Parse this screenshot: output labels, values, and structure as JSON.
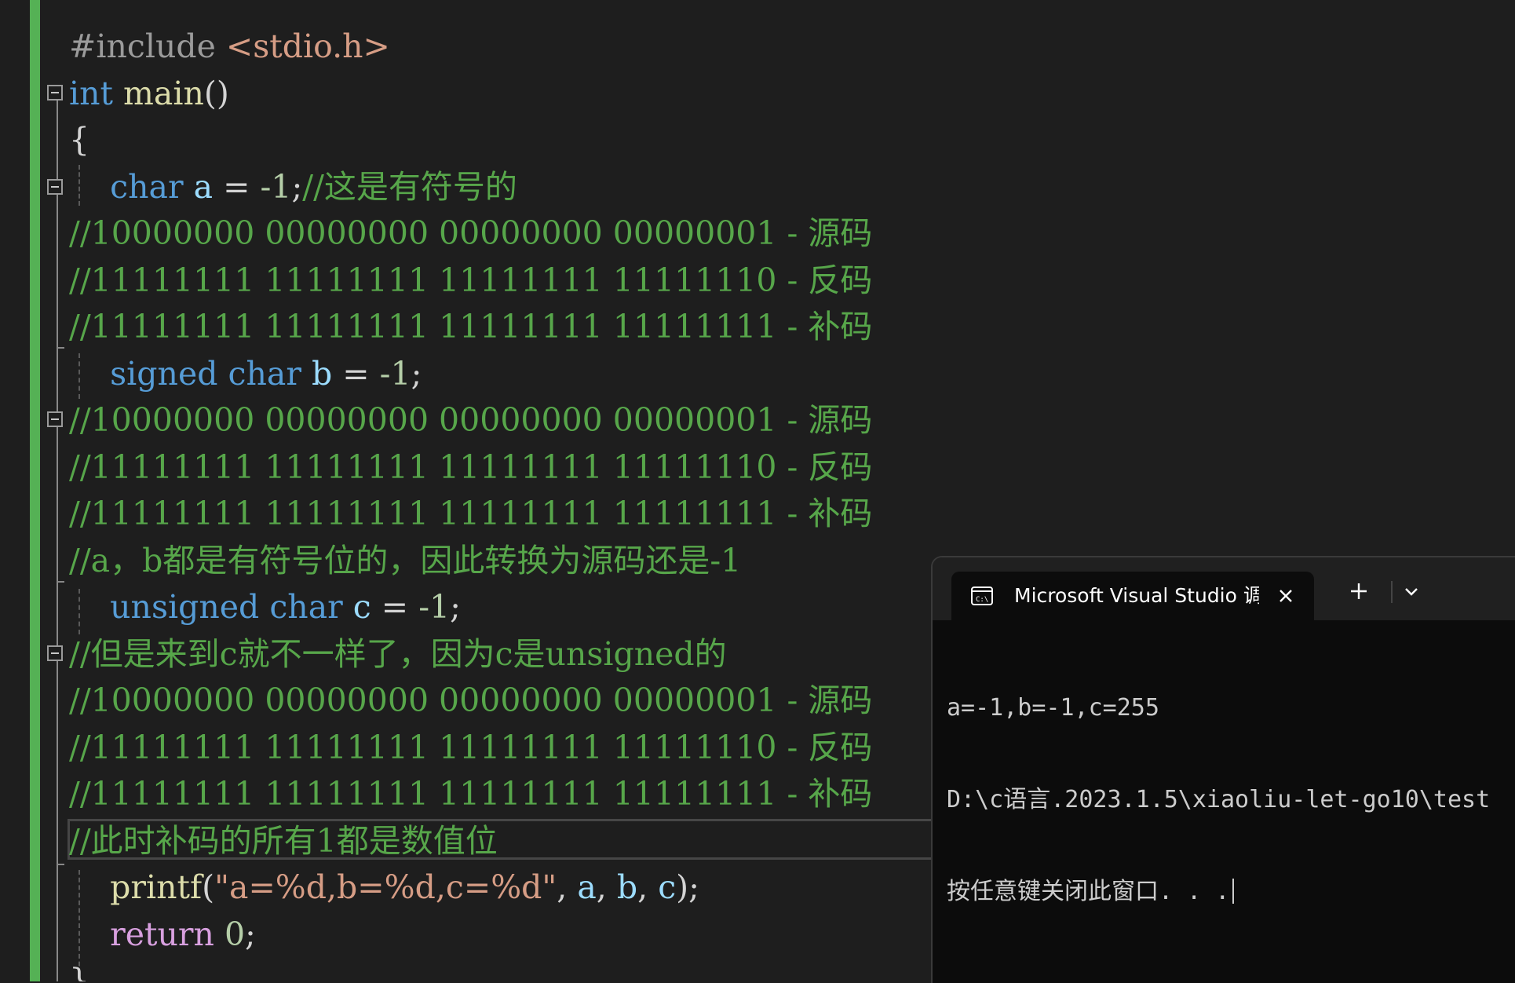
{
  "editor": {
    "lines": [
      {
        "tokens": [
          {
            "t": "#include ",
            "c": "pre"
          },
          {
            "t": "<stdio.h>",
            "c": "inc"
          }
        ]
      },
      {
        "tokens": [
          {
            "t": "int",
            "c": "kw"
          },
          {
            "t": " ",
            "c": "punc"
          },
          {
            "t": "main",
            "c": "fn"
          },
          {
            "t": "()",
            "c": "punc"
          }
        ]
      },
      {
        "tokens": [
          {
            "t": "{",
            "c": "punc"
          }
        ]
      },
      {
        "tokens": [
          {
            "t": "    ",
            "c": "punc"
          },
          {
            "t": "char",
            "c": "kw"
          },
          {
            "t": " ",
            "c": "punc"
          },
          {
            "t": "a",
            "c": "var"
          },
          {
            "t": " = ",
            "c": "punc"
          },
          {
            "t": "-1",
            "c": "num"
          },
          {
            "t": ";",
            "c": "punc"
          },
          {
            "t": "//这是有符号的",
            "c": "cmt"
          }
        ]
      },
      {
        "tokens": [
          {
            "t": "//10000000 00000000 00000000 00000001 - 源码",
            "c": "cmt"
          }
        ]
      },
      {
        "tokens": [
          {
            "t": "//11111111 11111111 11111111 11111110 - 反码",
            "c": "cmt"
          }
        ]
      },
      {
        "tokens": [
          {
            "t": "//11111111 11111111 11111111 11111111 - 补码",
            "c": "cmt"
          }
        ]
      },
      {
        "tokens": [
          {
            "t": "    ",
            "c": "punc"
          },
          {
            "t": "signed",
            "c": "kw"
          },
          {
            "t": " ",
            "c": "punc"
          },
          {
            "t": "char",
            "c": "kw"
          },
          {
            "t": " ",
            "c": "punc"
          },
          {
            "t": "b",
            "c": "var"
          },
          {
            "t": " = ",
            "c": "punc"
          },
          {
            "t": "-1",
            "c": "num"
          },
          {
            "t": ";",
            "c": "punc"
          }
        ]
      },
      {
        "tokens": [
          {
            "t": "//10000000 00000000 00000000 00000001 - 源码",
            "c": "cmt"
          }
        ]
      },
      {
        "tokens": [
          {
            "t": "//11111111 11111111 11111111 11111110 - 反码",
            "c": "cmt"
          }
        ]
      },
      {
        "tokens": [
          {
            "t": "//11111111 11111111 11111111 11111111 - 补码",
            "c": "cmt"
          }
        ]
      },
      {
        "tokens": [
          {
            "t": "//a，b都是有符号位的，因此转换为源码还是-1",
            "c": "cmt"
          }
        ]
      },
      {
        "tokens": [
          {
            "t": "    ",
            "c": "punc"
          },
          {
            "t": "unsigned",
            "c": "kw"
          },
          {
            "t": " ",
            "c": "punc"
          },
          {
            "t": "char",
            "c": "kw"
          },
          {
            "t": " ",
            "c": "punc"
          },
          {
            "t": "c",
            "c": "var"
          },
          {
            "t": " = ",
            "c": "punc"
          },
          {
            "t": "-1",
            "c": "num"
          },
          {
            "t": ";",
            "c": "punc"
          }
        ]
      },
      {
        "tokens": [
          {
            "t": "//但是来到c就不一样了，因为c是unsigned的",
            "c": "cmt"
          }
        ]
      },
      {
        "tokens": [
          {
            "t": "//10000000 00000000 00000000 00000001 - 源码",
            "c": "cmt"
          }
        ]
      },
      {
        "tokens": [
          {
            "t": "//11111111 11111111 11111111 11111110 - 反码",
            "c": "cmt"
          }
        ]
      },
      {
        "tokens": [
          {
            "t": "//11111111 11111111 11111111 11111111 - 补码",
            "c": "cmt"
          }
        ]
      },
      {
        "tokens": [
          {
            "t": "//此时补码的所有1都是数值位",
            "c": "cmt"
          }
        ]
      },
      {
        "tokens": [
          {
            "t": "    ",
            "c": "punc"
          },
          {
            "t": "printf",
            "c": "fn"
          },
          {
            "t": "(",
            "c": "punc"
          },
          {
            "t": "\"a=%d,b=%d,c=%d\"",
            "c": "str"
          },
          {
            "t": ", ",
            "c": "punc"
          },
          {
            "t": "a",
            "c": "var"
          },
          {
            "t": ", ",
            "c": "punc"
          },
          {
            "t": "b",
            "c": "var"
          },
          {
            "t": ", ",
            "c": "punc"
          },
          {
            "t": "c",
            "c": "var"
          },
          {
            "t": ");",
            "c": "punc"
          }
        ]
      },
      {
        "tokens": [
          {
            "t": "    ",
            "c": "punc"
          },
          {
            "t": "return",
            "c": "ret"
          },
          {
            "t": " ",
            "c": "punc"
          },
          {
            "t": "0",
            "c": "num"
          },
          {
            "t": ";",
            "c": "punc"
          }
        ]
      },
      {
        "tokens": [
          {
            "t": "}",
            "c": "punc"
          }
        ]
      }
    ]
  },
  "console": {
    "tab_title": "Microsoft Visual Studio 调试控制台",
    "tab_icon": "terminal-icon",
    "close_icon": "close-icon",
    "new_tab_icon": "plus-icon",
    "dropdown_icon": "chevron-down-icon",
    "output": {
      "line1": "a=-1,b=-1,c=255",
      "line2": "D:\\c语言.2023.1.5\\xiaoliu-let-go10\\test",
      "line3": "按任意键关闭此窗口. . ."
    }
  },
  "colors": {
    "editor_bg": "#1e1e1e",
    "gutter_change": "#55b155",
    "keyword": "#569cd6",
    "function": "#dcdcaa",
    "variable": "#9cdcfe",
    "number": "#b5cea8",
    "string": "#d69d85",
    "comment": "#57a64a",
    "return_keyword": "#d8a0df",
    "console_bg": "#0c0c0c"
  }
}
